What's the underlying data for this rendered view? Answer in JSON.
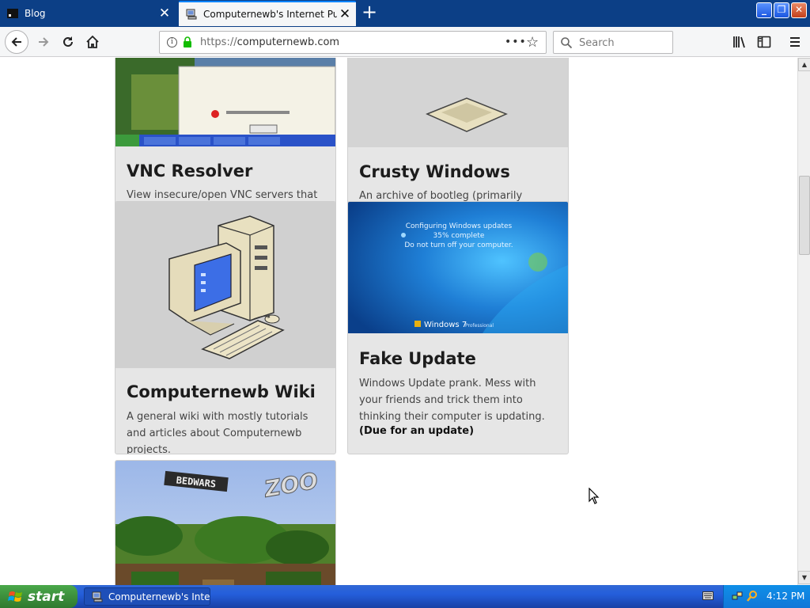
{
  "tabs": [
    {
      "title": "Blog",
      "active": false
    },
    {
      "title": "Computernewb's Internet Pub Hub!",
      "active": true
    }
  ],
  "window_controls": {
    "minimize": "_",
    "maximize": "❐",
    "close": "✕"
  },
  "nav": {
    "url_scheme": "https://",
    "url_host": "computernewb.com",
    "search_placeholder": "Search"
  },
  "cards": [
    {
      "title": "VNC Resolver",
      "text": "View insecure/open VNC servers that are scanned periodically. An API is also available."
    },
    {
      "title": "Crusty Windows",
      "text": "An archive of bootleg (primarily Windows) operating systems."
    },
    {
      "title": "Computernewb Wiki",
      "text": "A general wiki with mostly tutorials and articles about Computernewb projects."
    },
    {
      "title": "Fake Update",
      "text": "Windows Update prank. Mess with your friends and trick them into thinking their computer is updating.",
      "note": "(Due for an update)"
    }
  ],
  "update_screen": {
    "line1": "Configuring Windows updates",
    "line2": "35% complete",
    "line3": "Do not turn off your computer.",
    "brand": "Windows 7",
    "edition": "Professional"
  },
  "zoo_signs": {
    "bedwars": "BEDWARS",
    "zoo": "ZOO"
  },
  "taskbar": {
    "start_label": "start",
    "task_label": "Computernewb's Inte...",
    "clock": "4:12 PM"
  },
  "colors": {
    "tabstrip": "#0c3f86",
    "taskbar": "#245edb",
    "start": "#3c8f3c",
    "card_bg": "#e6e6e6",
    "lock": "#12bc00"
  }
}
